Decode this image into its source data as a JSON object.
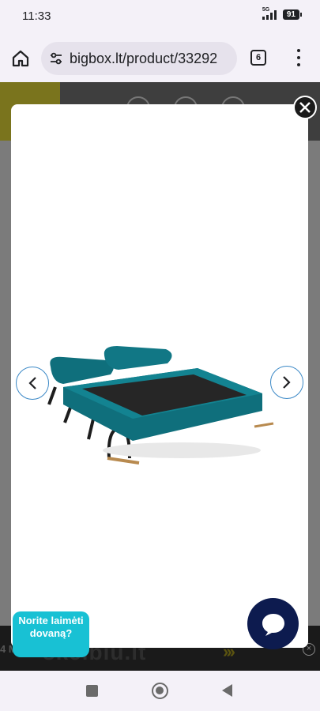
{
  "status_bar": {
    "time": "11:33",
    "network": "5G",
    "battery": "91"
  },
  "browser": {
    "url": "bigbox.lt/product/33292",
    "tab_count": "6"
  },
  "page": {
    "ad_text": "skelbiu.lt",
    "ad_small": "4 MĖN",
    "ad_arrows": "›››",
    "ad_close": "×"
  },
  "modal": {
    "image_alt": "Teal folding sofa bed opened flat",
    "image_color": "#0f6f7c"
  },
  "promo": {
    "label": "Norite laimėti dovaną?"
  },
  "colors": {
    "accent": "#18c1d4",
    "chat": "#0d1b4f",
    "nav_border": "#3a88c6"
  },
  "icons": {
    "home": "home-icon",
    "site_settings": "tune-icon",
    "menu": "more-vert-icon",
    "close": "close-icon",
    "prev": "chevron-left-icon",
    "next": "chevron-right-icon",
    "chat": "chat-bubble-icon"
  }
}
